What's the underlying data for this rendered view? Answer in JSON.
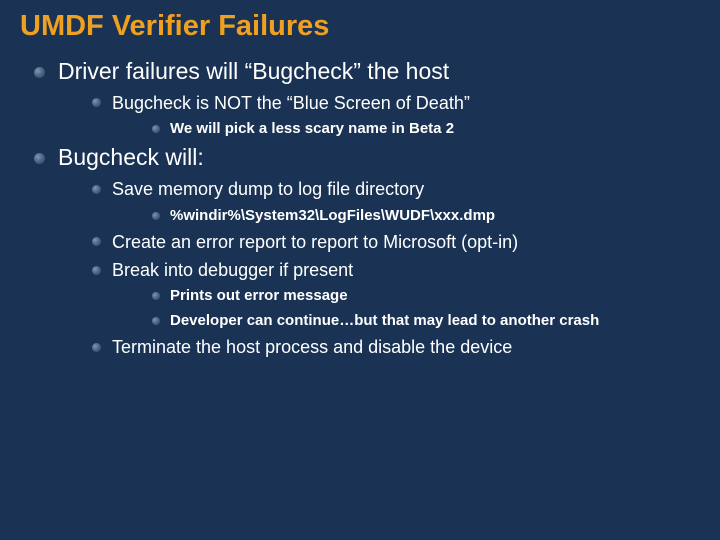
{
  "title": "UMDF Verifier Failures",
  "items": [
    {
      "text": "Driver failures will “Bugcheck” the host",
      "children": [
        {
          "text": "Bugcheck is NOT the “Blue Screen of Death”",
          "children": [
            {
              "text": "We will pick a less scary name in Beta 2"
            }
          ]
        }
      ]
    },
    {
      "text": "Bugcheck will:",
      "children": [
        {
          "text": "Save memory dump to log file directory",
          "children": [
            {
              "text": "%windir%\\System32\\LogFiles\\WUDF\\xxx.dmp"
            }
          ]
        },
        {
          "text": "Create an error report to report to Microsoft (opt-in)"
        },
        {
          "text": "Break into debugger if present",
          "children": [
            {
              "text": "Prints out error message"
            },
            {
              "text": "Developer can continue…but that may lead to another crash"
            }
          ]
        },
        {
          "text": "Terminate the host process and disable the device"
        }
      ]
    }
  ]
}
